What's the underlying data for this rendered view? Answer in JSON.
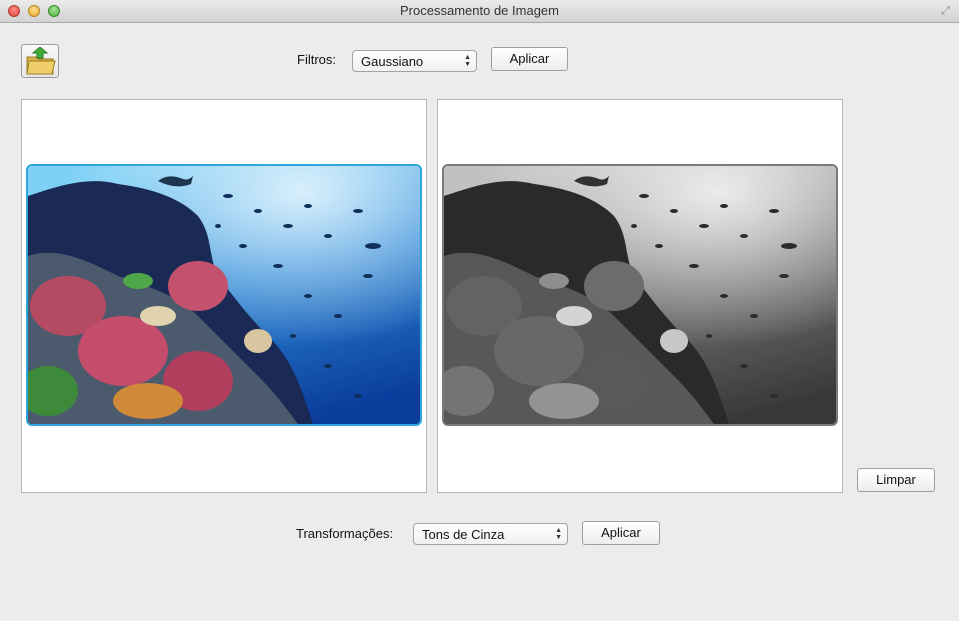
{
  "window": {
    "title": "Processamento de Imagem"
  },
  "toolbar": {
    "open_icon": "folder-open-icon",
    "filters_label": "Filtros:",
    "filters_selected": "Gaussiano",
    "filters_apply": "Aplicar"
  },
  "actions": {
    "clear_label": "Limpar"
  },
  "bottom": {
    "transform_label": "Transformações:",
    "transform_selected": "Tons de Cinza",
    "transform_apply": "Aplicar"
  },
  "colors": {
    "accent": "#2ea6dd",
    "window_bg": "#ececec"
  }
}
